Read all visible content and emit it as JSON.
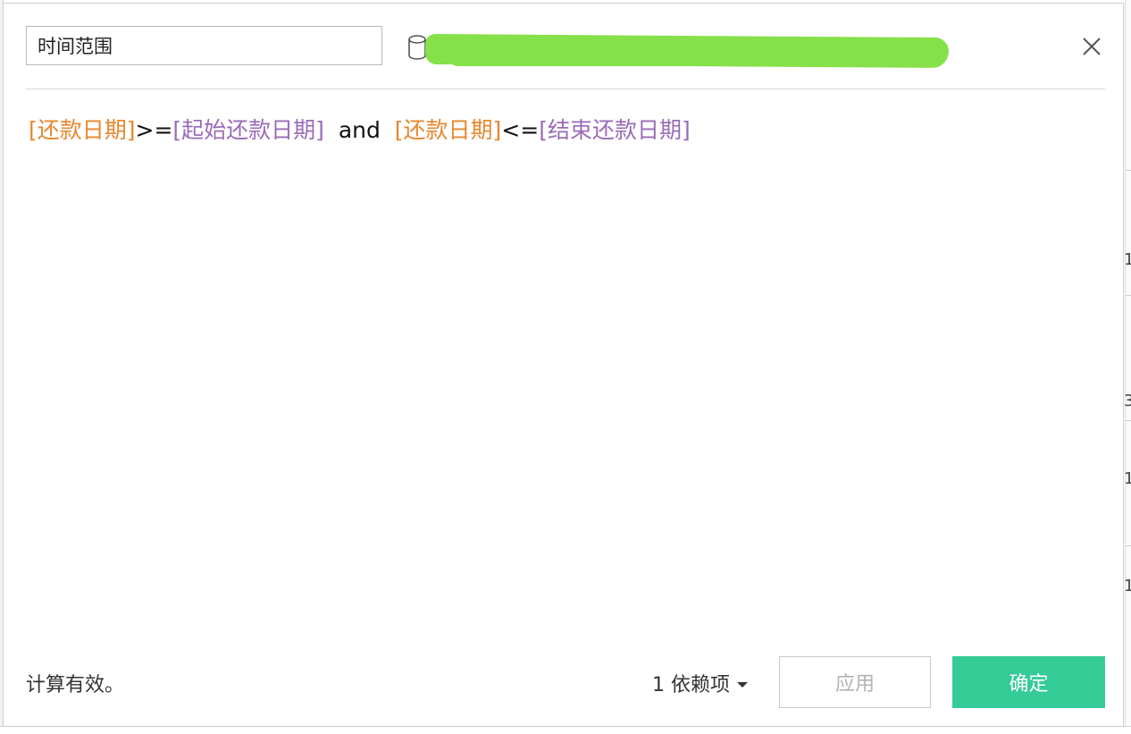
{
  "calc": {
    "name_value": "时间范围",
    "datasource_name": "                                        _",
    "formula_tokens": [
      {
        "t": "[还款日期]",
        "k": "field"
      },
      {
        "t": ">=",
        "k": "op"
      },
      {
        "t": "[起始还款日期]",
        "k": "param"
      },
      {
        "t": "  and  ",
        "k": "kw"
      },
      {
        "t": "[还款日期]",
        "k": "field"
      },
      {
        "t": "<=",
        "k": "op"
      },
      {
        "t": "[结束还款日期]",
        "k": "param"
      }
    ]
  },
  "footer": {
    "status": "计算有效。",
    "dependencies": "1 依赖项",
    "apply_label": "应用",
    "ok_label": "确定"
  },
  "colors": {
    "field": "#e8872e",
    "param": "#9a6bb7",
    "ok_button": "#34cb97",
    "redaction": "#86e04a"
  },
  "background": {
    "right_chars": [
      "1",
      "1",
      "3",
      "1",
      "1"
    ]
  }
}
